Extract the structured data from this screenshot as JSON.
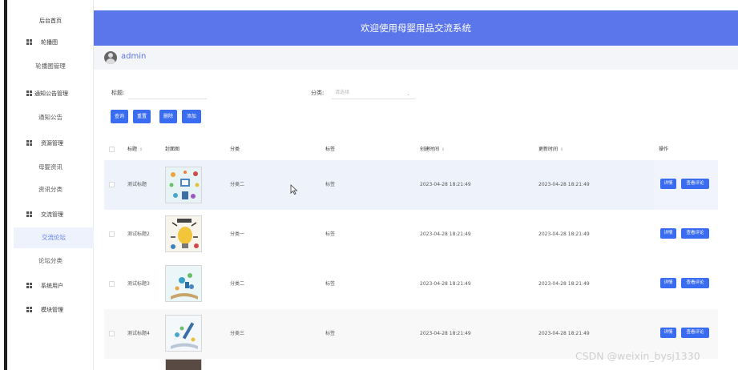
{
  "header": {
    "title": "欢迎使用母婴用品交流系统"
  },
  "user": {
    "name": "admin"
  },
  "sidebar": {
    "home": "后台首页",
    "groups": [
      {
        "label": "轮播图",
        "items": [
          "轮播图管理"
        ]
      },
      {
        "label": "通知公告管理",
        "items": [
          "通知公告"
        ]
      },
      {
        "label": "资源管理",
        "items": [
          "母婴资讯",
          "资讯分类"
        ]
      },
      {
        "label": "交流管理",
        "items": [
          "交流论坛",
          "论坛分类"
        ]
      },
      {
        "label": "系统用户",
        "items": []
      },
      {
        "label": "模块管理",
        "items": []
      }
    ],
    "active_item": "交流论坛"
  },
  "search": {
    "title_label": "标题:",
    "category_label": "分类:",
    "category_placeholder": "请选择",
    "buttons": [
      "查询",
      "重置",
      "删除",
      "添加"
    ]
  },
  "table": {
    "columns": [
      "标题",
      "封面图",
      "分类",
      "标签",
      "创建时间",
      "更新时间",
      "操作"
    ],
    "rows": [
      {
        "title": "测试标题",
        "category": "分类二",
        "tag": "标签",
        "created": "2023-04-28 18:21:49",
        "updated": "2023-04-28 18:21:49"
      },
      {
        "title": "测试标题2",
        "category": "分类一",
        "tag": "标签",
        "created": "2023-04-28 18:21:49",
        "updated": "2023-04-28 18:21:49"
      },
      {
        "title": "测试标题3",
        "category": "分类二",
        "tag": "标签",
        "created": "2023-04-28 18:21:49",
        "updated": "2023-04-28 18:21:49"
      },
      {
        "title": "测试标题4",
        "category": "分类三",
        "tag": "标签",
        "created": "2023-04-28 18:21:49",
        "updated": "2023-04-28 18:21:49"
      }
    ],
    "row_actions": [
      "详情",
      "查看评论"
    ]
  },
  "watermark": "CSDN @weixin_bysj1330",
  "colors": {
    "primary": "#5b76ea",
    "button": "#3a6cf1",
    "active_bg": "#eef2fd"
  }
}
